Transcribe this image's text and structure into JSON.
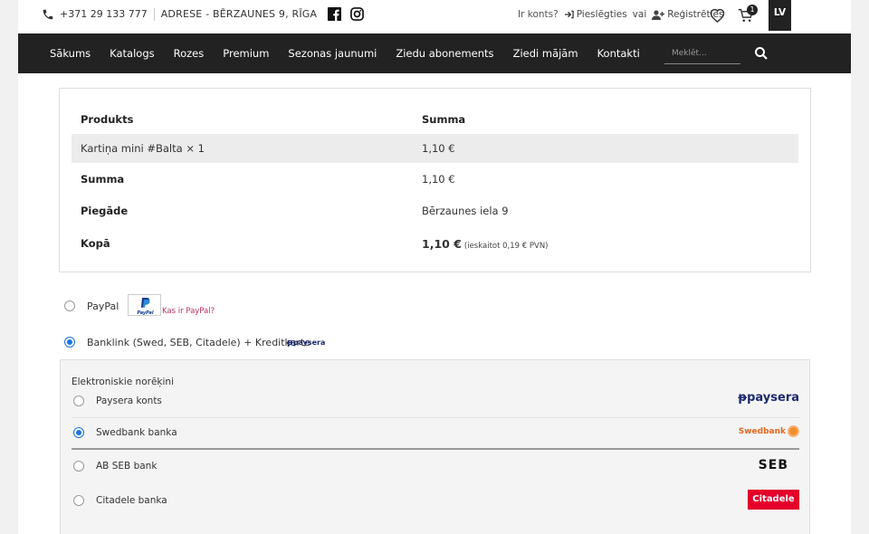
{
  "topbar": {
    "phone": "+371 29 133 777",
    "address": "ADRESE - BĒRZAUNES 9, RĪGA",
    "account_question": "Ir konts?",
    "login": "Pieslēgties",
    "or": "vai",
    "register": "Reģistrēties",
    "cart_count": "1",
    "language": "LV"
  },
  "nav": {
    "items": [
      "Sākums",
      "Katalogs",
      "Rozes",
      "Premium",
      "Sezonas jaunumi",
      "Ziedu abonements",
      "Ziedi mājām",
      "Kontakti"
    ],
    "search_placeholder": "Meklēt..."
  },
  "order": {
    "col_product": "Produkts",
    "col_sum": "Summa",
    "item_name": "Kartiņa mini #Balta",
    "item_qty": "× 1",
    "item_price": "1,10 €",
    "subtotal_label": "Summa",
    "subtotal_value": "1,10 €",
    "shipping_label": "Piegāde",
    "shipping_value": "Bērzaunes iela 9",
    "total_label": "Kopā",
    "total_value": "1,10 €",
    "total_tax": "(ieskaitot 0,19 € PVN)"
  },
  "payment": {
    "paypal_label": "PayPal",
    "paypal_logo": "PayPal",
    "paypal_what": "Kas ir PayPal?",
    "banklink_label": "Banklink (Swed, SEB, Citadele) + Kreditkarte",
    "banklink_logo": "paysera",
    "banks_title": "Elektroniskie norēķini",
    "banks": [
      {
        "name": "Paysera konts",
        "logo": "paysera",
        "selected": false
      },
      {
        "name": "Swedbank banka",
        "logo": "Swedbank",
        "selected": true
      },
      {
        "name": "AB SEB bank",
        "logo": "SEB",
        "selected": false
      },
      {
        "name": "Citadele banka",
        "logo": "Citadele",
        "selected": false
      }
    ]
  },
  "colors": {
    "nav_bg": "#222222",
    "accent_radio": "#1a73e8",
    "paypal_link": "#c03060",
    "citadele_red": "#e4002b",
    "swedbank_orange": "#e3661e",
    "paysera_blue": "#1b2a6e"
  }
}
